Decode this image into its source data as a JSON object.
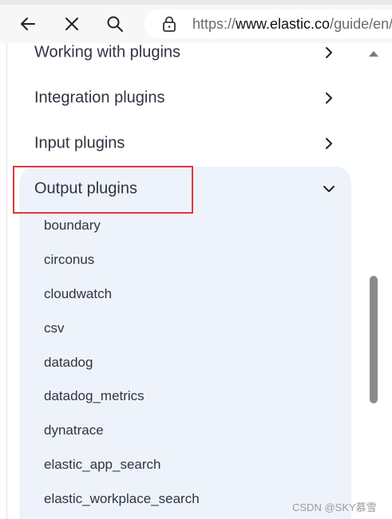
{
  "browser": {
    "url_scheme": "https://",
    "url_host": "www.elastic.co",
    "url_path": "/guide/en/",
    "icons": [
      "back-arrow-icon",
      "close-icon",
      "search-icon",
      "lock-icon"
    ]
  },
  "nav": {
    "items": [
      {
        "label": "Working with plugins"
      },
      {
        "label": "Integration plugins"
      },
      {
        "label": "Input plugins"
      },
      {
        "label": "Output plugins"
      }
    ],
    "output_plugins": [
      {
        "label": "boundary"
      },
      {
        "label": "circonus"
      },
      {
        "label": "cloudwatch"
      },
      {
        "label": "csv"
      },
      {
        "label": "datadog"
      },
      {
        "label": "datadog_metrics"
      },
      {
        "label": "dynatrace"
      },
      {
        "label": "elastic_app_search"
      },
      {
        "label": "elastic_workplace_search"
      }
    ]
  },
  "colors": {
    "highlight_border": "#e0373b",
    "expanded_panel_bg": "#eef3fb",
    "text": "#2f3440"
  },
  "watermark": "CSDN @SKY慕雪"
}
